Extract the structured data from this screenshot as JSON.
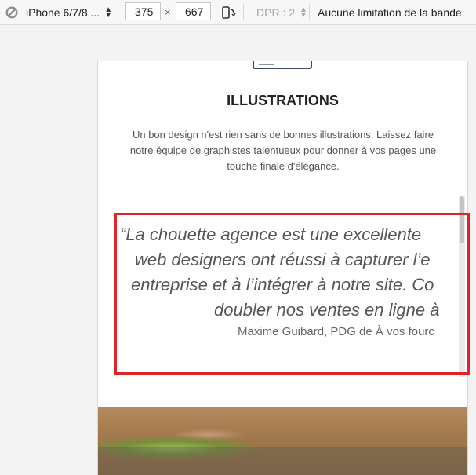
{
  "toolbar": {
    "device_label": "iPhone 6/7/8 ...",
    "width_value": "375",
    "times_symbol": "×",
    "height_value": "667",
    "dpr_label": "DPR : 2",
    "throttle_label": "Aucune limitation de la bande"
  },
  "page": {
    "heading": "ILLUSTRATIONS",
    "description": "Un bon design n'est rien sans de bonnes illustrations. Laissez faire notre équipe de graphistes talentueux pour donner à vos pages une touche finale d'élégance.",
    "quote_lines": [
      "“La chouette agence est une excellente",
      "web designers ont réussi à capturer l’e",
      "entreprise et à l’intégrer à notre site. Co",
      "doubler nos ventes en ligne à"
    ],
    "author": "Maxime Guibard, PDG de À vos fourc"
  },
  "colors": {
    "highlight": "#e0232a"
  }
}
